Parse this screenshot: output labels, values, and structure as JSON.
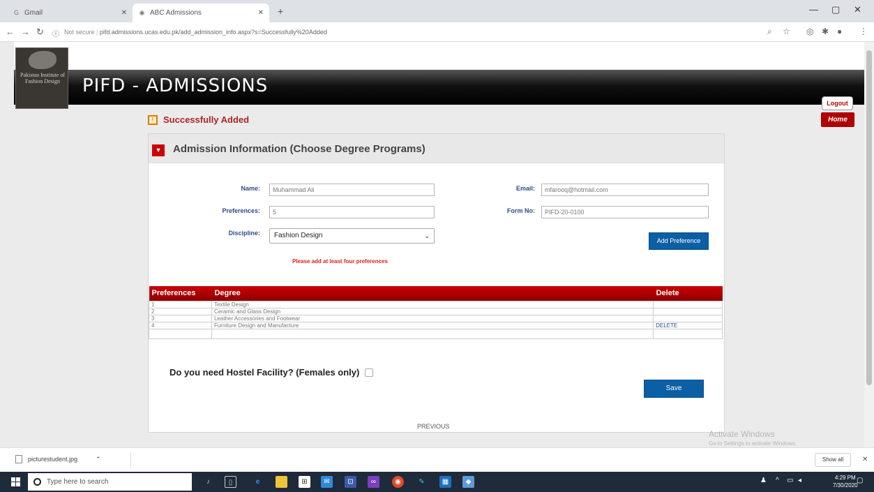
{
  "browser": {
    "tabs": [
      {
        "label": "Gmail"
      },
      {
        "label": "ABC Admissions"
      }
    ],
    "url_prefix": "Not secure",
    "url": "pifd.admissions.ucas.edu.pk/add_admission_info.aspx?s=Successfully%20Added"
  },
  "header": {
    "logo_text": "Pakistan Institute of Fashion Design",
    "title": "PIFD - ADMISSIONS",
    "logout_label": "Logout",
    "home_label": "Home"
  },
  "message": {
    "success": "Successfully Added"
  },
  "panel": {
    "title": "Admission Information (Choose Degree Programs)",
    "name_label": "Name:",
    "name_value": "Muhammad Ali",
    "email_label": "Email:",
    "email_value": "mfarooq@hotmail.com",
    "preferences_label": "Preferences:",
    "preferences_value": "5",
    "formno_label": "Form No:",
    "formno_value": "PIFD-20-0100",
    "discipline_label": "Discipline:",
    "discipline_value": "Fashion Design",
    "add_pref_label": "Add Preference",
    "warning": "Please add at least four preferences"
  },
  "table": {
    "headers": [
      "Preferences",
      "Degree",
      "Delete"
    ],
    "rows": [
      {
        "pref": "1",
        "degree": "Textile Design",
        "delete": ""
      },
      {
        "pref": "2",
        "degree": "Ceramic and Glass Design",
        "delete": ""
      },
      {
        "pref": "3",
        "degree": "Leather Accessories and Footwear",
        "delete": ""
      },
      {
        "pref": "4",
        "degree": "Furniture Design and Manufacture",
        "delete": "DELETE"
      }
    ]
  },
  "hostel": {
    "question": "Do you need Hostel Facility? (Females only)",
    "checked": false
  },
  "actions": {
    "save_label": "Save",
    "previous_label": "PREVIOUS"
  },
  "watermark": {
    "line1": "Activate Windows",
    "line2": "Go to Settings to activate Windows."
  },
  "downloads": {
    "file": "picturestudent.jpg",
    "show_all": "Show all"
  },
  "taskbar": {
    "search_placeholder": "Type here to search",
    "time": "4:29 PM",
    "date": "7/30/2020"
  }
}
